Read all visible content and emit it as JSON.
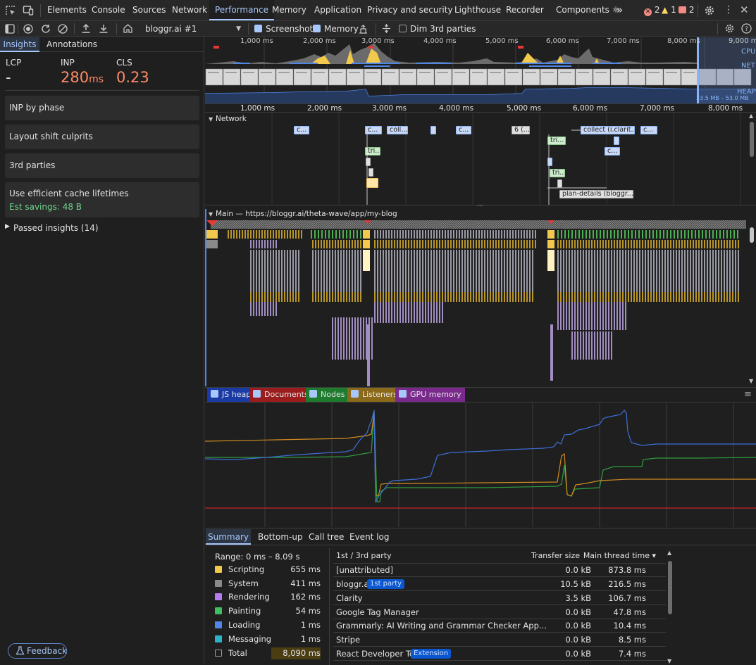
{
  "tabs": [
    {
      "label": "Elements"
    },
    {
      "label": "Console"
    },
    {
      "label": "Sources"
    },
    {
      "label": "Network"
    },
    {
      "label": "Performance"
    },
    {
      "label": "Memory"
    },
    {
      "label": "Application"
    },
    {
      "label": "Privacy and security"
    },
    {
      "label": "Lighthouse"
    },
    {
      "label": "Recorder"
    },
    {
      "label": "Components ⚛"
    }
  ],
  "status": {
    "errors": "2",
    "warnings": "1",
    "issues": "2"
  },
  "toolbar": {
    "recording_select": "bloggr.ai #1",
    "screenshots_label": "Screenshots",
    "memory_label": "Memory",
    "dim_label": "Dim 3rd parties"
  },
  "left": {
    "tabs": [
      "Insights",
      "Annotations"
    ],
    "metrics": [
      {
        "label": "LCP",
        "value": "-",
        "unit": ""
      },
      {
        "label": "INP",
        "value": "280",
        "unit": "ms"
      },
      {
        "label": "CLS",
        "value": "0.23",
        "unit": ""
      }
    ],
    "cards": [
      {
        "title": "INP by phase"
      },
      {
        "title": "Layout shift culprits"
      },
      {
        "title": "3rd parties"
      },
      {
        "title": "Use efficient cache lifetimes",
        "savings": "Est savings: 48 B"
      }
    ],
    "passed": "Passed insights (14)",
    "feedback": "Feedback"
  },
  "overview": {
    "ticks": [
      "1,000 ms",
      "2,000 ms",
      "3,000 ms",
      "4,000 ms",
      "5,000 ms",
      "6,000 ms",
      "7,000 ms",
      "8,000 ms",
      "9,000 ms"
    ],
    "labels": {
      "cpu": "CPU",
      "net": "NET",
      "heap": "HEAP",
      "heap_range": "33.5 MB – 53.0 MB"
    }
  },
  "ruler": {
    "ticks": [
      "1,000 ms",
      "2,000 ms",
      "3,000 ms",
      "4,000 ms",
      "5,000 ms",
      "6,000 ms",
      "7,000 ms",
      "8,000 ms"
    ]
  },
  "network": {
    "title": "Network",
    "requests": [
      {
        "label": "c..."
      },
      {
        "label": "c..."
      },
      {
        "label": "coll..."
      },
      {
        "label": ""
      },
      {
        "label": "c..."
      },
      {
        "label": "6 (..."
      },
      {
        "label": "collect (i.clarit..."
      },
      {
        "label": "c..."
      },
      {
        "label": "tri..."
      },
      {
        "label": "tri..."
      },
      {
        "label": "c..."
      },
      {
        "label": "tri..."
      },
      {
        "label": "plan-details (bloggr...."
      }
    ]
  },
  "main_track": {
    "title": "Main — https://bloggr.ai/theta-wave/app/my-blog"
  },
  "memory_legend": [
    {
      "label": "JS heap",
      "color": "#1a3aa6"
    },
    {
      "label": "Documents",
      "color": "#9b1c1c"
    },
    {
      "label": "Nodes",
      "color": "#1e7a2c"
    },
    {
      "label": "Listeners",
      "color": "#8a6a1a"
    },
    {
      "label": "GPU memory",
      "color": "#7a2a8c"
    }
  ],
  "bottom": {
    "tabs": [
      "Summary",
      "Bottom-up",
      "Call tree",
      "Event log"
    ],
    "range": "Range: 0 ms – 8.09 s",
    "categories": [
      {
        "name": "Scripting",
        "value": "655 ms",
        "color": "#f2c94c"
      },
      {
        "name": "System",
        "value": "411 ms",
        "color": "#8a8a8a"
      },
      {
        "name": "Rendering",
        "value": "162 ms",
        "color": "#b57cf0"
      },
      {
        "name": "Painting",
        "value": "54 ms",
        "color": "#3fbf5f"
      },
      {
        "name": "Loading",
        "value": "1 ms",
        "color": "#4f86e8"
      },
      {
        "name": "Messaging",
        "value": "1 ms",
        "color": "#2bb3c9"
      },
      {
        "name": "Total",
        "value": "8,090 ms",
        "color": ""
      }
    ],
    "table_headers": {
      "party": "1st / 3rd party",
      "transfer": "Transfer size",
      "time": "Main thread time ▾"
    },
    "rows": [
      {
        "name": "[unattributed]",
        "tag": "",
        "transfer": "0.0 kB",
        "time": "873.8 ms"
      },
      {
        "name": "bloggr.ai",
        "tag": "1st party",
        "transfer": "10.5 kB",
        "time": "216.5 ms"
      },
      {
        "name": "Clarity",
        "tag": "",
        "transfer": "3.5 kB",
        "time": "106.7 ms"
      },
      {
        "name": "Google Tag Manager",
        "tag": "",
        "transfer": "0.0 kB",
        "time": "47.8 ms"
      },
      {
        "name": "Grammarly: AI Writing and Grammar Checker App...",
        "tag": "",
        "transfer": "0.0 kB",
        "time": "10.4 ms"
      },
      {
        "name": "Stripe",
        "tag": "",
        "transfer": "0.0 kB",
        "time": "8.5 ms"
      },
      {
        "name": "React Developer Tools",
        "tag": "Extension",
        "transfer": "0.0 kB",
        "time": "7.4 ms"
      }
    ]
  }
}
